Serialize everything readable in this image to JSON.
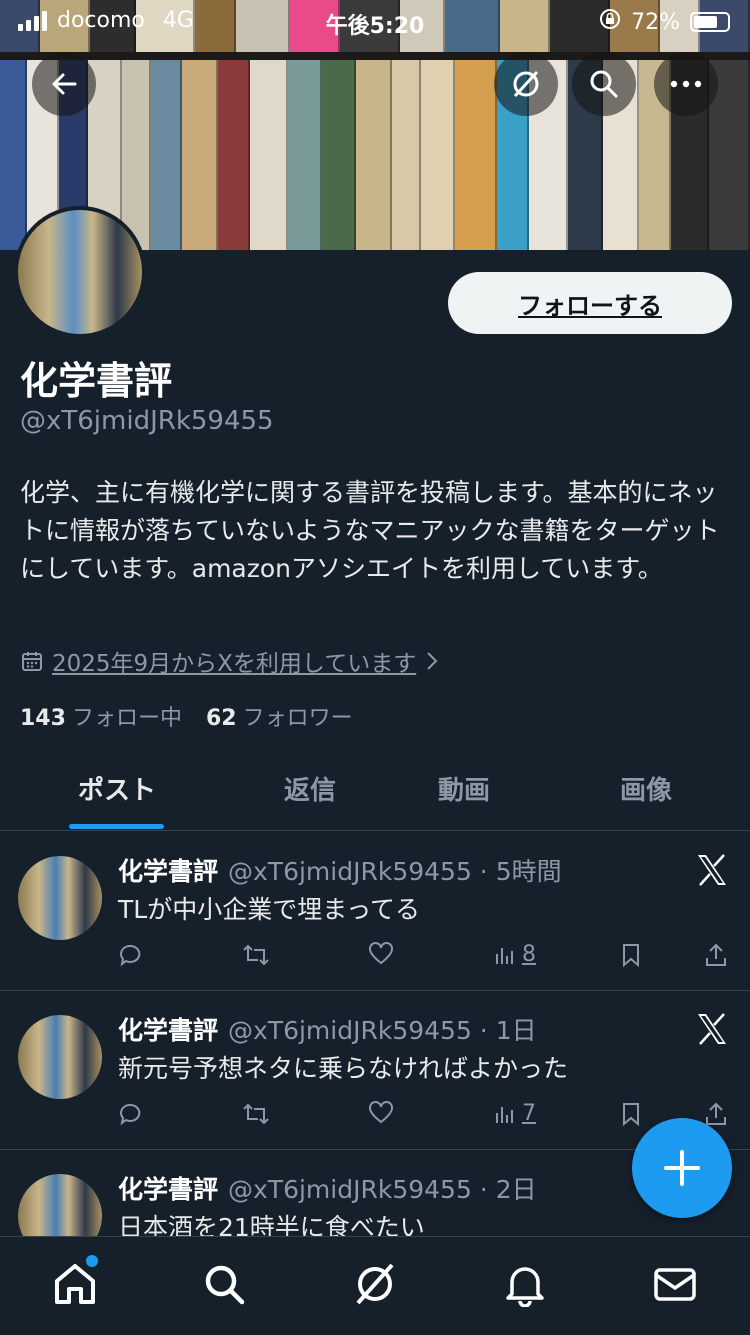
{
  "status_bar": {
    "carrier": "docomo",
    "network": "4G",
    "time": "午後5:20",
    "battery": "72%",
    "battery_level": 0.72
  },
  "header": {
    "back_icon": "arrow-left-icon",
    "grok_icon": "grok-icon",
    "search_icon": "search-icon",
    "more_icon": "more-icon"
  },
  "profile": {
    "name": "化学書評",
    "handle": "@xT6jmidJRk59455",
    "follow_button": "フォローする",
    "bio": "化学、主に有機化学に関する書評を投稿します。基本的にネットに情報が落ちていないようなマニアックな書籍をターゲットにしています。amazonアソシエイトを利用しています。",
    "joined": "2025年9月からXを利用しています",
    "following_count": "143",
    "following_label": "フォロー中",
    "followers_count": "62",
    "followers_label": "フォロワー"
  },
  "tabs": [
    {
      "label": "ポスト",
      "active": true
    },
    {
      "label": "返信",
      "active": false
    },
    {
      "label": "動画",
      "active": false
    },
    {
      "label": "画像",
      "active": false
    }
  ],
  "posts": [
    {
      "name": "化学書評",
      "handle": "@xT6jmidJRk59455",
      "time": "5時間",
      "text": "TLが中小企業で埋まってる",
      "views": "8"
    },
    {
      "name": "化学書評",
      "handle": "@xT6jmidJRk59455",
      "time": "1日",
      "text": "新元号予想ネタに乗らなければよかった",
      "views": "7"
    },
    {
      "name": "化学書評",
      "handle": "@xT6jmidJRk59455",
      "time": "2日",
      "text": "日本酒を21時半に食べたい",
      "views": ""
    }
  ],
  "fab": {
    "label": "+"
  },
  "bottom_nav": [
    "home-icon",
    "search-icon",
    "grok-icon",
    "notifications-icon",
    "messages-icon"
  ]
}
